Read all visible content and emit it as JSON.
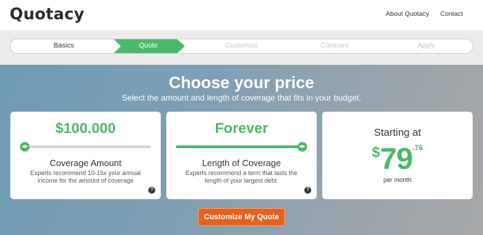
{
  "header": {
    "logo": "Quotacy",
    "nav": [
      {
        "label": "About Quotacy"
      },
      {
        "label": "Contact"
      }
    ]
  },
  "steps": {
    "items": [
      {
        "label": "Basics",
        "state": "completed"
      },
      {
        "label": "Quote",
        "state": "active"
      },
      {
        "label": "Customize",
        "state": "upcoming"
      },
      {
        "label": "Compare",
        "state": "upcoming"
      },
      {
        "label": "Apply",
        "state": "upcoming"
      }
    ]
  },
  "hero": {
    "title": "Choose your price",
    "subtitle": "Select the amount and length of coverage that fits in your budget."
  },
  "coverage_amount": {
    "value": "$100.000",
    "slider_fraction": 0.0,
    "label": "Coverage Amount",
    "help": "Experts recommend 10-15x your annual income for the amount of coverage",
    "info_icon": "question-circle-icon"
  },
  "coverage_length": {
    "value": "Forever",
    "slider_fraction": 1.0,
    "label": "Length of Coverage",
    "help": "Experts recommend a term that lasts the length of your largest debt.",
    "info_icon": "question-circle-icon"
  },
  "price": {
    "label": "Starting at",
    "currency": "$",
    "dollars": "79",
    "cents": ".76",
    "period": "per month"
  },
  "cta": {
    "label": "Customize My Quote"
  },
  "colors": {
    "accent_green": "#4cb96a",
    "cta_orange": "#e8611c",
    "hero_blue": "#6f9bb4",
    "hero_gray": "#a7a8a9"
  }
}
